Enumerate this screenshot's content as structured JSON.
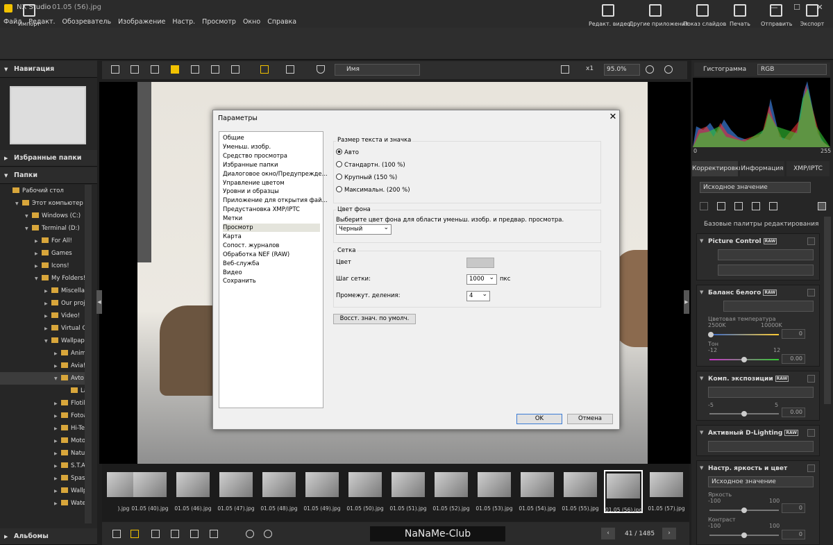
{
  "app": {
    "name": "NX Studio",
    "document": "01.05 (56).jpg"
  },
  "window": {
    "minimize": "—",
    "maximize": "☐",
    "close": "✕"
  },
  "menu": [
    "Файл",
    "Редакт.",
    "Обозреватель",
    "Изображение",
    "Настр.",
    "Просмотр",
    "Окно",
    "Справка"
  ],
  "toolbar": {
    "import": "Импорт",
    "video_edit": "Редакт. видео",
    "other_apps": "Другие приложения",
    "slideshow": "Показ слайдов",
    "print": "Печать",
    "send": "Отправить",
    "export": "Экспорт"
  },
  "left": {
    "navigation": "Навигация",
    "favorites": "Избранные папки",
    "folders": "Папки",
    "albums": "Альбомы"
  },
  "tree": [
    {
      "label": "Рабочий стол",
      "depth": 0
    },
    {
      "label": "Этот компьютер",
      "depth": 1
    },
    {
      "label": "Windows (C:)",
      "depth": 2
    },
    {
      "label": "Terminal (D:)",
      "depth": 2
    },
    {
      "label": "For All!",
      "depth": 3
    },
    {
      "label": "Games",
      "depth": 3
    },
    {
      "label": "Icons!",
      "depth": 3
    },
    {
      "label": "My Folders!",
      "depth": 3
    },
    {
      "label": "Miscellane",
      "depth": 4
    },
    {
      "label": "Our projec",
      "depth": 4
    },
    {
      "label": "Video!",
      "depth": 4
    },
    {
      "label": "Virtual CD!",
      "depth": 4
    },
    {
      "label": "Wallpaper",
      "depth": 4
    },
    {
      "label": "Animal",
      "depth": 5
    },
    {
      "label": "Avia!",
      "depth": 5
    },
    {
      "label": "Avto!",
      "depth": 5
    },
    {
      "label": "Lac",
      "depth": 6
    },
    {
      "label": "Flotilla",
      "depth": 5
    },
    {
      "label": "Fotoall",
      "depth": 5
    },
    {
      "label": "Hi-Tech",
      "depth": 5
    },
    {
      "label": "Moto!",
      "depth": 5
    },
    {
      "label": "Nature",
      "depth": 5
    },
    {
      "label": "S.T.A.L.",
      "depth": 5
    },
    {
      "label": "Spase!",
      "depth": 5
    },
    {
      "label": "Wallpa",
      "depth": 5
    },
    {
      "label": "Water!",
      "depth": 5
    }
  ],
  "center": {
    "sort": "Имя",
    "zoom_x1": "x1",
    "zoom": "95.0%"
  },
  "dialog": {
    "title": "Параметры",
    "close": "✕",
    "categories": [
      "Общие",
      "Уменьш. изобр.",
      "Средство просмотра",
      "Избранные папки",
      "Диалоговое окно/Предупрежде...",
      "Управление цветом",
      "Уровни и образцы",
      "Приложение для открытия фай...",
      "Предустановка XMP/IPTC",
      "Метки",
      "Просмотр",
      "Карта",
      "Сопост. журналов",
      "Обработка NEF (RAW)",
      "Веб-служба",
      "Видео",
      "Сохранить"
    ],
    "selected_category": "Просмотр",
    "size_group": "Размер текста и значка",
    "size_options": [
      "Авто",
      "Стандартн. (100 %)",
      "Крупный (150 %)",
      "Максимальн. (200 %)"
    ],
    "bg_group": "Цвет фона",
    "bg_desc": "Выберите цвет фона для области уменьш. изобр. и предвар. просмотра.",
    "bg_value": "Черный",
    "grid_group": "Сетка",
    "grid_color": "Цвет",
    "grid_step": "Шаг сетки:",
    "grid_step_value": "1000",
    "grid_unit": "пкс",
    "grid_div": "Промежут. деления:",
    "grid_div_value": "4",
    "restore": "Восст. знач. по умолч.",
    "ok": "OK",
    "cancel": "Отмена"
  },
  "film": [
    ").jpg",
    "01.05 (40).jpg",
    "01.05 (46).jpg",
    "01.05 (47).jpg",
    "01.05 (48).jpg",
    "01.05 (49).jpg",
    "01.05 (50).jpg",
    "01.05 (51).jpg",
    "01.05 (52).jpg",
    "01.05 (53).jpg",
    "01.05 (54).jpg",
    "01.05 (55).jpg",
    "01.05 (56).jpg",
    "01.05 (57).jpg"
  ],
  "bottom": {
    "watermark": "NaNaMe-Club",
    "pager": "41 / 1485"
  },
  "right": {
    "histogram": "Гистограмма",
    "channel": "RGB",
    "hist_min": "0",
    "hist_max": "255",
    "tabs": [
      "Корректировки",
      "Информация",
      "XMP/IPTC"
    ],
    "preset": "Исходное значение",
    "basic": "Базовые палитры редактирования",
    "picture_control": "Picture Control",
    "wb": "Баланс белого",
    "wb_temp": "Цветовая температура",
    "wb_t1": "2500K",
    "wb_t2": "10000K",
    "wb_val": "0",
    "tint": "Тон",
    "tint_min": "-12",
    "tint_max": "12",
    "tint_val": "0.00",
    "exposure": "Комп. экспозиции",
    "exp_min": "-5",
    "exp_max": "5",
    "exp_val": "0.00",
    "dlighting": "Активный D-Lighting",
    "brightness": "Настр. яркость и цвет",
    "br_preset": "Исходное значение",
    "bright": "Яркость",
    "b_min": "-100",
    "b_max": "100",
    "b_val": "0",
    "contrast": "Контраст",
    "c_min": "-100",
    "c_max": "100",
    "c_val": "0",
    "raw": "RAW"
  }
}
